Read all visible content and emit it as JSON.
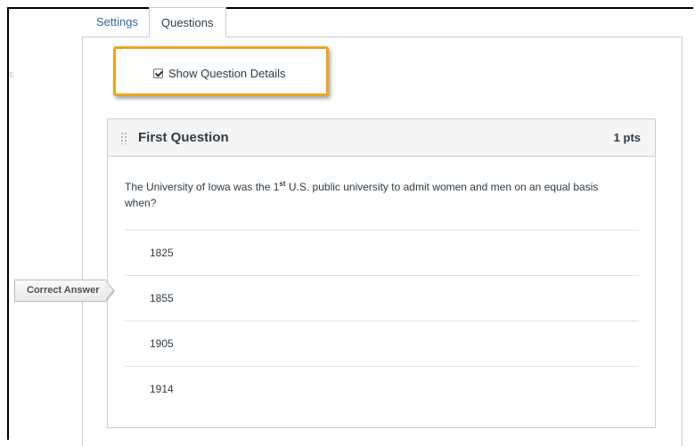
{
  "sidebar": {
    "partial_text": "s"
  },
  "tabs": [
    {
      "label": "Settings",
      "active": false
    },
    {
      "label": "Questions",
      "active": true
    }
  ],
  "options": {
    "show_details_label": "Show Question Details",
    "show_details_checked": true
  },
  "question": {
    "title": "First Question",
    "points": "1 pts",
    "text_before": "The University of Iowa was the 1",
    "text_sup": "st",
    "text_after": " U.S. public university to admit women and men on an equal basis when?",
    "answers": [
      "1825",
      "1855",
      "1905",
      "1914"
    ],
    "correct_answer_label": "Correct Answer",
    "correct_index": 1
  },
  "colors": {
    "highlight_border": "#f0a219",
    "link": "#2d6ba8"
  }
}
